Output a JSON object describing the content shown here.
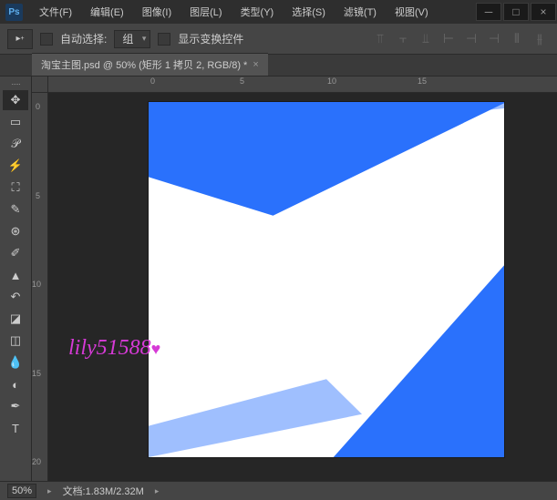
{
  "app": {
    "logo": "Ps"
  },
  "menu": {
    "file": "文件(F)",
    "edit": "编辑(E)",
    "image": "图像(I)",
    "layer": "图层(L)",
    "type": "类型(Y)",
    "select": "选择(S)",
    "filter": "滤镜(T)",
    "view": "视图(V)"
  },
  "options": {
    "auto_select": "自动选择:",
    "group": "组",
    "show_transform": "显示变换控件"
  },
  "tab": {
    "title": "淘宝主图.psd @ 50% (矩形 1 拷贝 2, RGB/8) *",
    "close": "×"
  },
  "ruler": {
    "h": [
      "0",
      "5",
      "10",
      "15"
    ],
    "v": [
      "0",
      "5",
      "10",
      "15",
      "20"
    ]
  },
  "watermark": "lily51588",
  "status": {
    "zoom": "50%",
    "doc_label": "文档:",
    "doc_size": "1.83M/2.32M"
  }
}
